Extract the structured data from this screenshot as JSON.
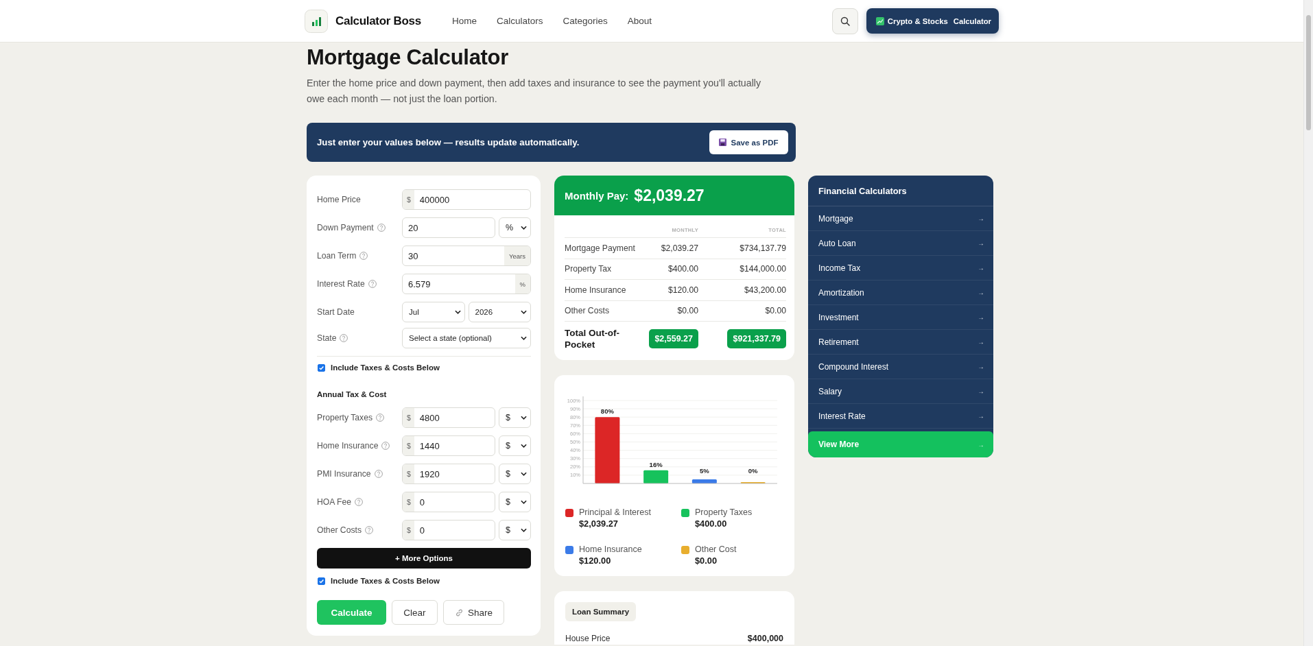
{
  "header": {
    "brand": "Calculator Boss",
    "nav": [
      {
        "label": "Home"
      },
      {
        "label": "Calculators"
      },
      {
        "label": "Categories"
      },
      {
        "label": "About"
      }
    ],
    "cta": {
      "parts": [
        "Crypto & Stocks",
        "Calculator"
      ]
    }
  },
  "page": {
    "title": "Mortgage Calculator",
    "description": "Enter the home price and down payment, then add taxes and insurance to see the payment you'll actually owe each month — not just the loan portion."
  },
  "banner": {
    "text": "Just enter your values below — results update automatically.",
    "button": "Save as PDF"
  },
  "form": {
    "fields": [
      {
        "label": "Home Price",
        "help": false,
        "kind": "input",
        "prefix": "$",
        "value": "400000"
      },
      {
        "label": "Down Payment",
        "help": true,
        "kind": "input",
        "value": "20",
        "unit": "%"
      },
      {
        "label": "Loan Term",
        "help": true,
        "kind": "input",
        "value": "30",
        "suffix": "Years"
      },
      {
        "label": "Interest Rate",
        "help": true,
        "kind": "input",
        "value": "6.579",
        "suffix": "%"
      },
      {
        "label": "Start Date",
        "help": false,
        "kind": "selects",
        "values": [
          "Jul",
          "2026"
        ]
      },
      {
        "label": "State",
        "help": true,
        "kind": "selects",
        "values": [
          "Select a state (optional)"
        ]
      }
    ],
    "include_taxes": {
      "label": "Include Taxes & Costs Below",
      "checked": true
    },
    "section_title": "Annual Tax & Cost",
    "tax_fields": [
      {
        "label": "Property Taxes",
        "help": true,
        "kind": "input",
        "prefix": "$",
        "value": "4800",
        "unit": "$"
      },
      {
        "label": "Home Insurance",
        "help": true,
        "kind": "input",
        "prefix": "$",
        "value": "1440",
        "unit": "$"
      },
      {
        "label": "PMI Insurance",
        "help": true,
        "kind": "input",
        "prefix": "$",
        "value": "1920",
        "unit": "$"
      },
      {
        "label": "HOA Fee",
        "help": true,
        "kind": "input",
        "prefix": "$",
        "value": "0",
        "unit": "$"
      },
      {
        "label": "Other Costs",
        "help": true,
        "kind": "input",
        "prefix": "$",
        "value": "0",
        "unit": "$"
      }
    ],
    "more_options": "+ More Options",
    "include_taxes_bottom": {
      "label": "Include Taxes & Costs Below",
      "checked": true
    },
    "actions": [
      {
        "label": "Calculate",
        "kind": "primary"
      },
      {
        "label": "Clear",
        "kind": "plain"
      },
      {
        "label": "Share",
        "kind": "share"
      }
    ]
  },
  "results": {
    "headline_label": "Monthly Pay:",
    "headline_value": "$2,039.27",
    "columns": [
      "MONTHLY",
      "TOTAL"
    ],
    "rows": [
      {
        "label": "Mortgage Payment",
        "monthly": "$2,039.27",
        "total": "$734,137.79"
      },
      {
        "label": "Property Tax",
        "monthly": "$400.00",
        "total": "$144,000.00"
      },
      {
        "label": "Home Insurance",
        "monthly": "$120.00",
        "total": "$43,200.00"
      },
      {
        "label": "Other Costs",
        "monthly": "$0.00",
        "total": "$0.00"
      }
    ],
    "total": {
      "label": "Total Out-of-Pocket",
      "monthly": "$2,559.27",
      "total": "$921,337.79"
    }
  },
  "breakdown": {
    "chart_data": {
      "type": "bar",
      "values": [
        80,
        16,
        5,
        0
      ],
      "ylim": [
        0,
        100
      ],
      "yticks": [
        {
          "value": 10,
          "label": "10%"
        },
        {
          "value": 20,
          "label": "20%"
        },
        {
          "value": 30,
          "label": "30%"
        },
        {
          "value": 40,
          "label": "40%"
        },
        {
          "value": 50,
          "label": "50%"
        },
        {
          "value": 60,
          "label": "60%"
        },
        {
          "value": 70,
          "label": "70%"
        },
        {
          "value": 80,
          "label": "80%"
        },
        {
          "value": 90,
          "label": "90%"
        },
        {
          "value": 100,
          "label": "100%"
        }
      ],
      "value_labels": [
        "80%",
        "16%",
        "5%",
        "0%"
      ],
      "grid": true
    },
    "legend": [
      {
        "name": "Principal & Interest",
        "value": "$2,039.27",
        "color": "#dc2626"
      },
      {
        "name": "Property Taxes",
        "value": "$400.00",
        "color": "#16c25c"
      },
      {
        "name": "Home Insurance",
        "value": "$120.00",
        "color": "#3b7be8"
      },
      {
        "name": "Other Cost",
        "value": "$0.00",
        "color": "#e8ae2e"
      }
    ]
  },
  "loan_summary": {
    "title": "Loan Summary",
    "rows": [
      {
        "label": "House Price",
        "value": "$400,000"
      }
    ]
  },
  "sidebar": {
    "title": "Financial Calculators",
    "items": [
      {
        "label": "Mortgage",
        "arrow": "→",
        "kind": "link"
      },
      {
        "label": "Auto Loan",
        "arrow": "→",
        "kind": "link"
      },
      {
        "label": "Income Tax",
        "arrow": "→",
        "kind": "link"
      },
      {
        "label": "Amortization",
        "arrow": "→",
        "kind": "link"
      },
      {
        "label": "Investment",
        "arrow": "→",
        "kind": "link"
      },
      {
        "label": "Retirement",
        "arrow": "→",
        "kind": "link"
      },
      {
        "label": "Compound Interest",
        "arrow": "→",
        "kind": "link"
      },
      {
        "label": "Salary",
        "arrow": "→",
        "kind": "link"
      },
      {
        "label": "Interest Rate",
        "arrow": "→",
        "kind": "link"
      },
      {
        "label": "View More",
        "arrow": "→",
        "kind": "more"
      }
    ]
  }
}
